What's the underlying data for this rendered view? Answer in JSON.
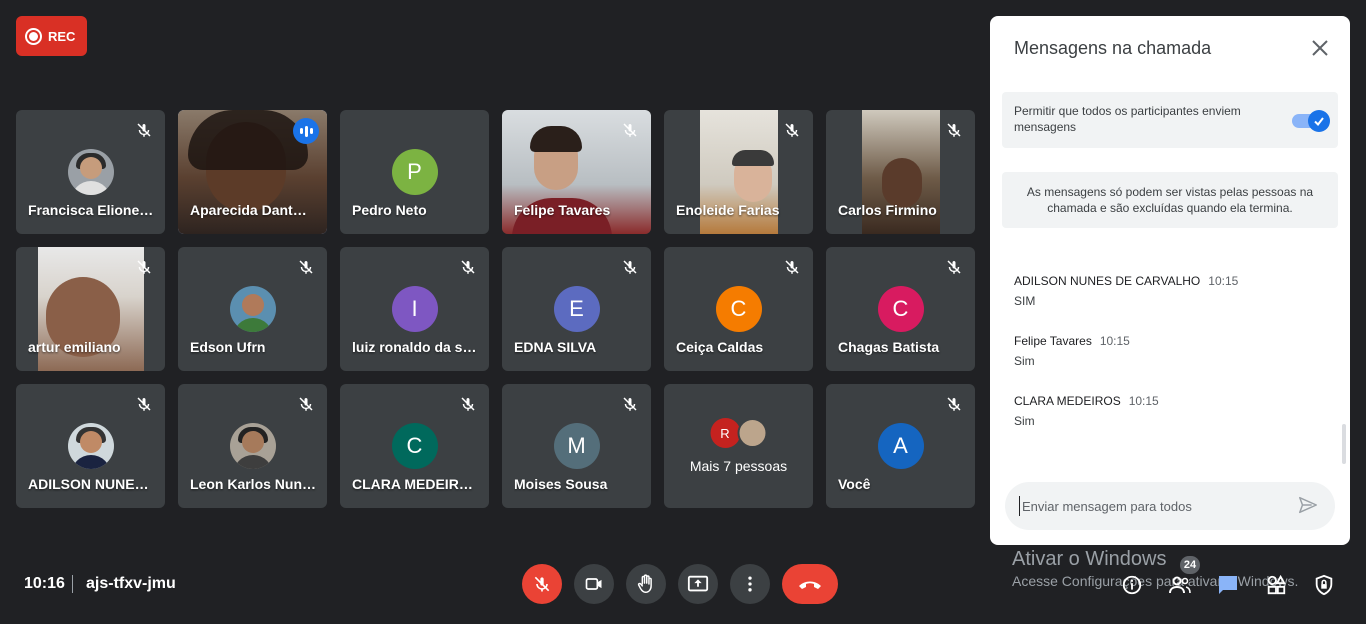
{
  "rec": {
    "label": "REC"
  },
  "tiles": [
    {
      "name": "Francisca Elionet…"
    },
    {
      "name": "Aparecida Dant…"
    },
    {
      "name": "Pedro Neto",
      "initial": "P",
      "color": "#7cb342"
    },
    {
      "name": "Felipe Tavares"
    },
    {
      "name": "Enoleide Farias"
    },
    {
      "name": "Carlos Firmino"
    },
    {
      "name": "artur emiliano"
    },
    {
      "name": "Edson Ufrn"
    },
    {
      "name": "luiz ronaldo da sil…",
      "initial": "I",
      "color": "#7e57c2"
    },
    {
      "name": "EDNA SILVA",
      "initial": "E",
      "color": "#5c6bc0"
    },
    {
      "name": "Ceiça Caldas",
      "initial": "C",
      "color": "#f57c00"
    },
    {
      "name": "Chagas Batista",
      "initial": "C",
      "color": "#d81b60"
    },
    {
      "name": "ADILSON NUNES…"
    },
    {
      "name": "Leon Karlos Nunes"
    },
    {
      "name": "CLARA MEDEIROS",
      "initial": "C",
      "color": "#00695c"
    },
    {
      "name": "Moises Sousa",
      "initial": "M",
      "color": "#546e7a"
    },
    {
      "name": "Mais 7 pessoas",
      "initial": "R",
      "color": "#c5221f"
    },
    {
      "name": "Você",
      "initial": "A",
      "color": "#1565c0"
    }
  ],
  "panel": {
    "title": "Mensagens na chamada",
    "permission_text": "Permitir que todos os participantes enviem mensagens",
    "permission_on": true,
    "info_text": "As mensagens só podem ser vistas pelas pessoas na chamada e são excluídas quando ela termina.",
    "messages": [
      {
        "sender": "ADILSON NUNES DE CARVALHO",
        "time": "10:15",
        "text": "SIM"
      },
      {
        "sender": "Felipe Tavares",
        "time": "10:15",
        "text": "Sim"
      },
      {
        "sender": "CLARA MEDEIROS",
        "time": "10:15",
        "text": "Sim"
      }
    ],
    "compose_placeholder": "Enviar mensagem para todos"
  },
  "bottom": {
    "time": "10:16",
    "meeting_code": "ajs-tfxv-jmu",
    "participants_count": "24",
    "controls": [
      "mic-off-icon",
      "camera-icon",
      "raise-hand-icon",
      "present-screen-icon",
      "more-options-icon",
      "end-call-icon"
    ],
    "right_icons": [
      "info-icon",
      "people-icon",
      "chat-icon",
      "activities-icon",
      "host-controls-icon"
    ]
  },
  "windows_overlay": {
    "title": "Ativar o Windows",
    "subtitle": "Acesse Configurações para ativar o Windows."
  },
  "colors": {
    "background": "#202124",
    "tile": "#3c4043",
    "accent": "#1a73e8",
    "danger": "#ea4335"
  }
}
